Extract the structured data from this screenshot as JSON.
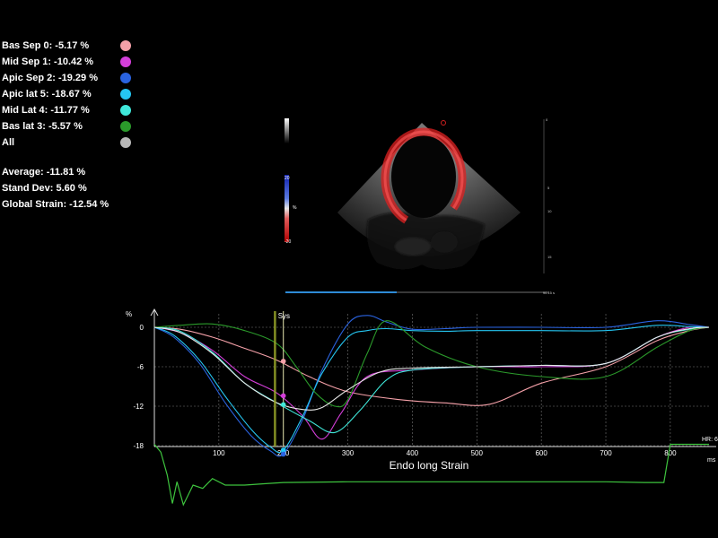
{
  "legend": [
    {
      "label": "Bas Sep 0: -5.17 %",
      "color": "#f4a0a8"
    },
    {
      "label": "Mid Sep 1: -10.42 %",
      "color": "#d43ed9"
    },
    {
      "label": "Apic Sep 2: -19.29 %",
      "color": "#2a63e0"
    },
    {
      "label": "Apic lat 5: -18.67 %",
      "color": "#25c6f2"
    },
    {
      "label": "Mid Lat 4: -11.77 %",
      "color": "#3fe8da"
    },
    {
      "label": "Bas lat 3: -5.57 %",
      "color": "#2b9a2b"
    },
    {
      "label": "All",
      "color": "#b8b8b8"
    }
  ],
  "stats": {
    "average": "Average: -11.81 %",
    "std": "Stand Dev: 5.60 %",
    "global": "Global Strain: -12.54 %"
  },
  "echo": {
    "scale_top": "20",
    "scale_bottom": "-20",
    "scale_unit": "%",
    "depth_labels": [
      "5",
      "10",
      "15"
    ],
    "bottom_readout": "90.15 s"
  },
  "chart_data": {
    "type": "line",
    "xlabel": "Endo long Strain",
    "ylabel": "%",
    "x_unit": "ms",
    "xlim": [
      0,
      860
    ],
    "ylim": [
      -21,
      1.5
    ],
    "xticks": [
      100,
      200,
      300,
      400,
      500,
      600,
      700,
      800
    ],
    "yticks": [
      0,
      -6,
      -12,
      -18
    ],
    "ytick_labels": [
      "0",
      "-6",
      "-12",
      "-18"
    ],
    "grid": true,
    "sys_label": "Sys",
    "sys_x": 187,
    "marker_x": 200,
    "hr_label": "HR: 6",
    "series": [
      {
        "name": "Bas Sep 0",
        "color": "#f4a0a8",
        "x": [
          0,
          40,
          90,
          140,
          190,
          240,
          300,
          380,
          450,
          520,
          600,
          700,
          780,
          830,
          860
        ],
        "y": [
          0,
          -0.3,
          -1.5,
          -3.2,
          -5.0,
          -7.5,
          -9.8,
          -11.0,
          -11.5,
          -11.7,
          -8.5,
          -6.0,
          -2.0,
          -0.5,
          0
        ]
      },
      {
        "name": "Mid Sep 1",
        "color": "#d43ed9",
        "x": [
          0,
          40,
          90,
          140,
          190,
          230,
          260,
          290,
          330,
          400,
          500,
          600,
          700,
          780,
          830,
          860
        ],
        "y": [
          0,
          -0.8,
          -3.5,
          -7.5,
          -10.0,
          -13.5,
          -17.0,
          -13.0,
          -7.5,
          -6.5,
          -6.0,
          -6.0,
          -5.5,
          -1.5,
          0,
          0
        ]
      },
      {
        "name": "Apic Sep 2",
        "color": "#2a63e0",
        "x": [
          0,
          30,
          70,
          110,
          150,
          180,
          200,
          230,
          260,
          300,
          330,
          360,
          400,
          450,
          500,
          600,
          700,
          780,
          830,
          860
        ],
        "y": [
          0,
          -1.5,
          -5.5,
          -11.5,
          -16.5,
          -18.8,
          -19.3,
          -14.0,
          -6.5,
          0.5,
          1.8,
          0.8,
          -0.3,
          -0.2,
          0,
          0,
          0,
          1.0,
          0.4,
          0
        ]
      },
      {
        "name": "Apic lat 5",
        "color": "#25c6f2",
        "x": [
          0,
          30,
          70,
          110,
          150,
          180,
          200,
          230,
          260,
          300,
          330,
          360,
          400,
          450,
          500,
          600,
          700,
          780,
          830,
          860
        ],
        "y": [
          0,
          -1.2,
          -5.0,
          -10.5,
          -15.5,
          -18.2,
          -18.7,
          -13.5,
          -7.0,
          -1.5,
          -0.5,
          -0.2,
          -0.5,
          -0.6,
          -0.5,
          -0.5,
          -0.5,
          0.3,
          0.1,
          0
        ]
      },
      {
        "name": "Mid Lat 4",
        "color": "#3fe8da",
        "x": [
          0,
          40,
          90,
          140,
          190,
          240,
          280,
          320,
          360,
          400,
          500,
          600,
          700,
          780,
          830,
          860
        ],
        "y": [
          0,
          -0.6,
          -3.8,
          -8.5,
          -11.5,
          -14.2,
          -16.0,
          -12.5,
          -8.0,
          -6.5,
          -6.0,
          -5.8,
          -5.5,
          -1.5,
          -0.3,
          0
        ]
      },
      {
        "name": "Bas lat 3",
        "color": "#2b9a2b",
        "x": [
          0,
          40,
          90,
          140,
          190,
          220,
          250,
          280,
          300,
          330,
          360,
          420,
          500,
          600,
          700,
          780,
          830,
          860
        ],
        "y": [
          0,
          0.3,
          0.5,
          -0.5,
          -2.5,
          -6.0,
          -10.0,
          -12.0,
          -11.0,
          -4.0,
          1.0,
          -3.0,
          -6.0,
          -7.5,
          -7.5,
          -3.0,
          -0.5,
          0
        ]
      },
      {
        "name": "All",
        "color": "#e8e8e8",
        "x": [
          0,
          40,
          90,
          140,
          190,
          230,
          260,
          300,
          350,
          400,
          500,
          600,
          700,
          780,
          830,
          860
        ],
        "y": [
          0,
          -0.8,
          -4.0,
          -8.5,
          -11.5,
          -12.5,
          -12.2,
          -9.5,
          -6.8,
          -6.2,
          -6.0,
          -5.8,
          -5.5,
          -1.5,
          -0.2,
          0
        ]
      }
    ],
    "marker_points": [
      {
        "series": "Bas Sep 0",
        "y": -5.17
      },
      {
        "series": "Mid Sep 1",
        "y": -10.42
      },
      {
        "series": "Mid Lat 4",
        "y": -11.77
      },
      {
        "series": "Apic lat 5",
        "y": -18.67
      },
      {
        "series": "Apic Sep 2",
        "y": -19.29
      }
    ],
    "ecg": {
      "color": "#3ec43e",
      "x": [
        0,
        10,
        20,
        28,
        35,
        45,
        60,
        75,
        90,
        110,
        140,
        170,
        200,
        300,
        400,
        500,
        600,
        700,
        760,
        790,
        800,
        830,
        860
      ],
      "y": [
        -17.8,
        -19.0,
        -22.5,
        -26.8,
        -23.5,
        -27.0,
        -24.0,
        -24.5,
        -23.0,
        -24.0,
        -24.0,
        -23.8,
        -23.6,
        -23.5,
        -23.5,
        -23.5,
        -23.5,
        -23.5,
        -23.6,
        -23.6,
        -17.8,
        -17.8,
        -17.8
      ]
    }
  }
}
